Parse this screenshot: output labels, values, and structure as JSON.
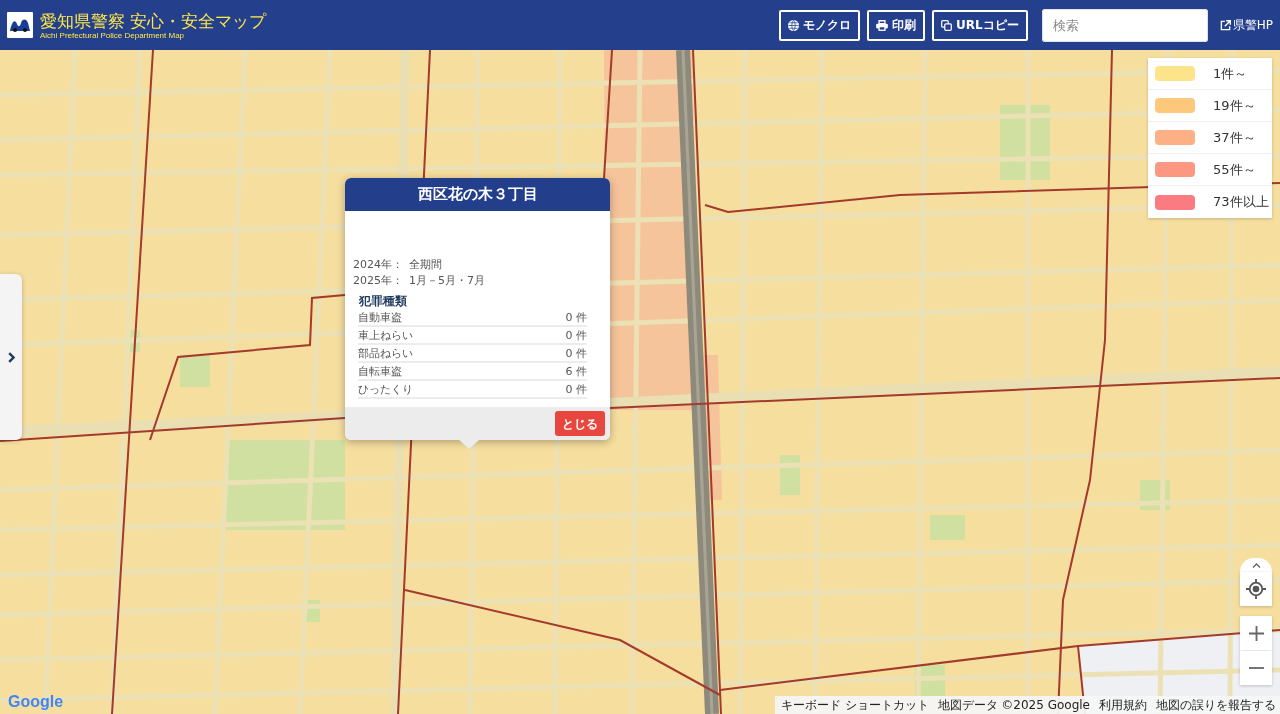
{
  "header": {
    "title": "愛知県警察 安心・安全マップ",
    "subtitle": "Aichi Prefectural Police Department Map",
    "buttons": [
      {
        "kind": "globe",
        "label": "モノクロ"
      },
      {
        "kind": "print",
        "label": "印刷"
      },
      {
        "kind": "copy",
        "label": "URLコピー"
      }
    ],
    "search": {
      "placeholder": "検索"
    },
    "link": {
      "label": "県警HP"
    }
  },
  "legend": [
    {
      "label": "1件～",
      "color": "#fde48a"
    },
    {
      "label": "19件～",
      "color": "#fdc87c"
    },
    {
      "label": "37件～",
      "color": "#fcb083"
    },
    {
      "label": "55件～",
      "color": "#fc9882"
    },
    {
      "label": "73件以上",
      "color": "#fb7c80"
    }
  ],
  "popup": {
    "title": "西区花の木３丁目",
    "periods": [
      {
        "year": "2024年：",
        "months": "全期間"
      },
      {
        "year": "2025年：",
        "months": "1月－5月・7月"
      }
    ],
    "section_title": "犯罪種類",
    "crimes": [
      {
        "name": "自動車盗",
        "count": "0 件"
      },
      {
        "name": "車上ねらい",
        "count": "0 件"
      },
      {
        "name": "部品ねらい",
        "count": "0 件"
      },
      {
        "name": "自転車盗",
        "count": "6 件"
      },
      {
        "name": "ひったくり",
        "count": "0 件"
      }
    ],
    "close_button": "とじる"
  },
  "attribution": {
    "logo": "Google",
    "items": [
      "キーボード ショートカット",
      "地図データ ©2025 Google",
      "利用規約",
      "地図の誤りを報告する"
    ]
  }
}
